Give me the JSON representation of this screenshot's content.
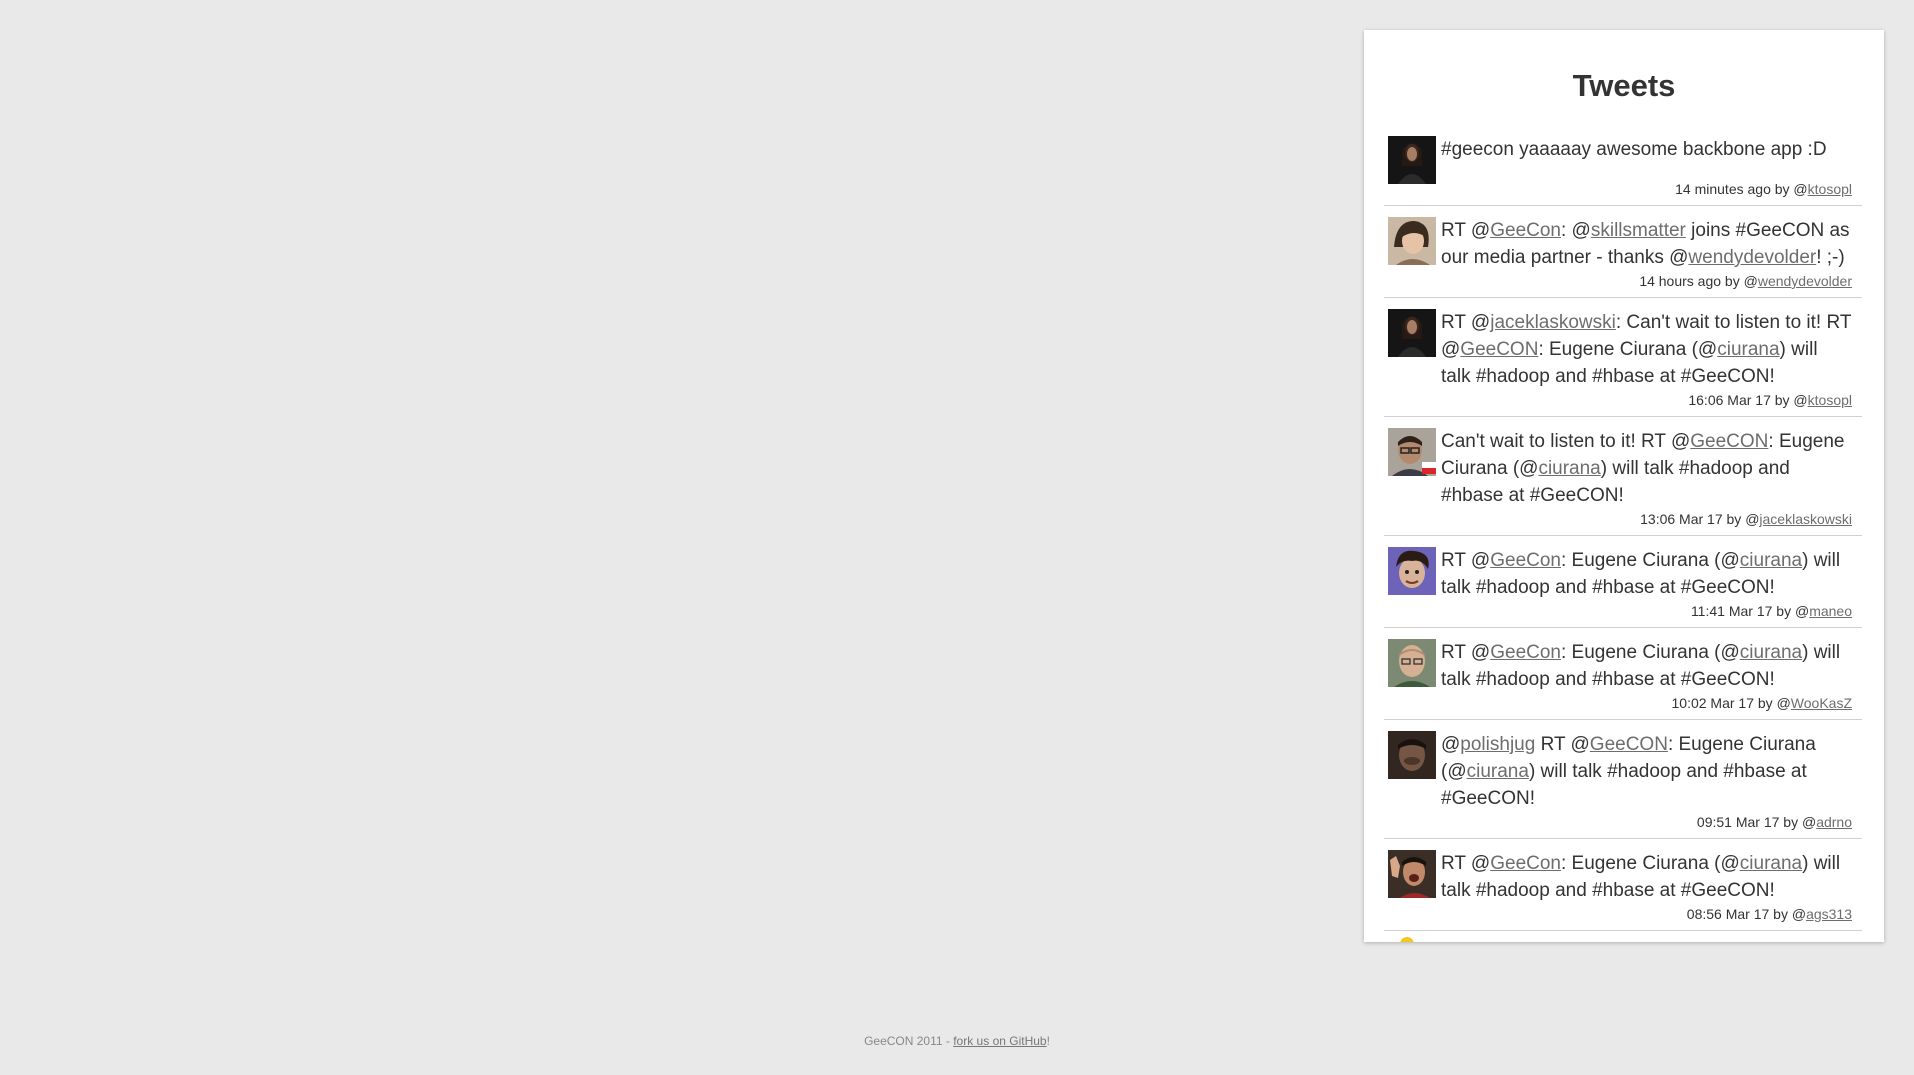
{
  "panel": {
    "title": "Tweets"
  },
  "tweets": [
    {
      "avatar": "woman-dark-avatar",
      "segments": [
        {
          "t": "#geecon yaaaaay awesome backbone app :D"
        }
      ],
      "time": "14 minutes ago",
      "by": " by @",
      "user": "ktosopl"
    },
    {
      "avatar": "woman-light-avatar",
      "segments": [
        {
          "t": "RT @"
        },
        {
          "t": "GeeCon",
          "link": true
        },
        {
          "t": ": @"
        },
        {
          "t": "skillsmatter",
          "link": true
        },
        {
          "t": " joins #GeeCON as our media partner - thanks @"
        },
        {
          "t": "wendydevolder",
          "link": true
        },
        {
          "t": "! ;-)"
        }
      ],
      "time": "14 hours ago",
      "by": " by @",
      "user": "wendydevolder"
    },
    {
      "avatar": "woman-dark-avatar",
      "segments": [
        {
          "t": "RT @"
        },
        {
          "t": "jaceklaskowski",
          "link": true
        },
        {
          "t": ": Can't wait to listen to it! RT @"
        },
        {
          "t": "GeeCON",
          "link": true
        },
        {
          "t": ": Eugene Ciurana (@"
        },
        {
          "t": "ciurana",
          "link": true
        },
        {
          "t": ") will talk #hadoop and #hbase at #GeeCON!"
        }
      ],
      "time": "16:06 Mar 17",
      "by": " by @",
      "user": "ktosopl"
    },
    {
      "avatar": "man-glasses-avatar",
      "segments": [
        {
          "t": "Can't wait to listen to it! RT @"
        },
        {
          "t": "GeeCON",
          "link": true
        },
        {
          "t": ": Eugene Ciurana (@"
        },
        {
          "t": "ciurana",
          "link": true
        },
        {
          "t": ") will talk #hadoop and #hbase at #GeeCON!"
        }
      ],
      "time": "13:06 Mar 17",
      "by": " by @",
      "user": "jaceklaskowski"
    },
    {
      "avatar": "man-curly-avatar",
      "segments": [
        {
          "t": "RT @"
        },
        {
          "t": "GeeCon",
          "link": true
        },
        {
          "t": ": Eugene Ciurana (@"
        },
        {
          "t": "ciurana",
          "link": true
        },
        {
          "t": ") will talk #hadoop and #hbase at #GeeCON!"
        }
      ],
      "time": "11:41 Mar 17",
      "by": " by @",
      "user": "maneo"
    },
    {
      "avatar": "man-bald-avatar",
      "segments": [
        {
          "t": "RT @"
        },
        {
          "t": "GeeCon",
          "link": true
        },
        {
          "t": ": Eugene Ciurana (@"
        },
        {
          "t": "ciurana",
          "link": true
        },
        {
          "t": ") will talk #hadoop and #hbase at #GeeCON!"
        }
      ],
      "time": "10:02 Mar 17",
      "by": " by @",
      "user": "WooKasZ"
    },
    {
      "avatar": "man-dark-avatar",
      "segments": [
        {
          "t": "@"
        },
        {
          "t": "polishjug",
          "link": true
        },
        {
          "t": " RT @"
        },
        {
          "t": "GeeCON",
          "link": true
        },
        {
          "t": ": Eugene Ciurana (@"
        },
        {
          "t": "ciurana",
          "link": true
        },
        {
          "t": ") will talk #hadoop and #hbase at #GeeCON!"
        }
      ],
      "time": "09:51 Mar 17",
      "by": " by @",
      "user": "adrno"
    },
    {
      "avatar": "man-waving-avatar",
      "segments": [
        {
          "t": "RT @"
        },
        {
          "t": "GeeCon",
          "link": true
        },
        {
          "t": ": Eugene Ciurana (@"
        },
        {
          "t": "ciurana",
          "link": true
        },
        {
          "t": ") will talk #hadoop and #hbase at #GeeCON!"
        }
      ],
      "time": "08:56 Mar 17",
      "by": " by @",
      "user": "ags313"
    }
  ],
  "footer": {
    "prefix": "GeeCON 2011 - ",
    "link": "fork us on GitHub",
    "suffix": "!"
  },
  "colors": {
    "background": "#e9e9e9",
    "panel": "#ffffff",
    "link": "#6d6d6d",
    "loading_dot": "#f2c81e"
  }
}
